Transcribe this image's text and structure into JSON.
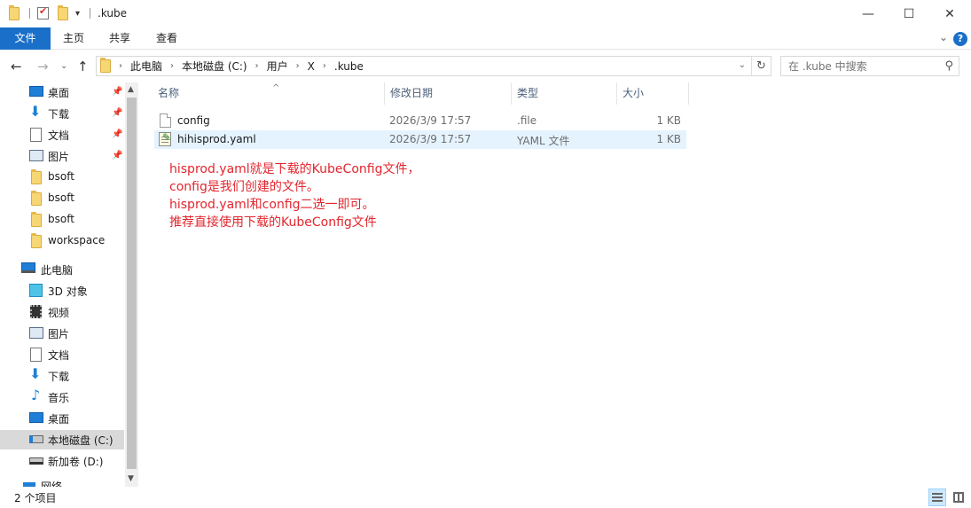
{
  "window": {
    "title": ".kube",
    "minimize_icon": "minimize-icon",
    "maximize_icon": "maximize-icon",
    "close_icon": "close-icon"
  },
  "ribbon": {
    "tabs": [
      "文件",
      "主页",
      "共享",
      "查看"
    ],
    "help_glyph": "?"
  },
  "address": {
    "crumbs": [
      "此电脑",
      "本地磁盘 (C:)",
      "用户",
      "X",
      ".kube"
    ],
    "search_placeholder": "在 .kube 中搜索"
  },
  "sidebar": {
    "quick_access": [
      {
        "label": "桌面",
        "icon": "desktop-icon",
        "pinned": true
      },
      {
        "label": "下载",
        "icon": "download-icon",
        "pinned": true
      },
      {
        "label": "文档",
        "icon": "documents-icon",
        "pinned": true
      },
      {
        "label": "图片",
        "icon": "pictures-icon",
        "pinned": true
      },
      {
        "label": "bsoft",
        "icon": "folder-icon",
        "pinned": false
      },
      {
        "label": "bsoft",
        "icon": "folder-icon",
        "pinned": false
      },
      {
        "label": "bsoft",
        "icon": "folder-icon",
        "pinned": false
      },
      {
        "label": "workspace",
        "icon": "folder-icon",
        "pinned": false
      }
    ],
    "this_pc": "此电脑",
    "pc_items": [
      {
        "label": "3D 对象",
        "icon": "3d-objects-icon"
      },
      {
        "label": "视频",
        "icon": "videos-icon"
      },
      {
        "label": "图片",
        "icon": "pictures-icon"
      },
      {
        "label": "文档",
        "icon": "documents-icon"
      },
      {
        "label": "下载",
        "icon": "download-icon"
      },
      {
        "label": "音乐",
        "icon": "music-icon"
      },
      {
        "label": "桌面",
        "icon": "desktop-icon"
      },
      {
        "label": "本地磁盘 (C:)",
        "icon": "drive-c-icon",
        "selected": true
      },
      {
        "label": "新加卷 (D:)",
        "icon": "drive-d-icon"
      }
    ],
    "partial_item": "网络"
  },
  "columns": {
    "name": "名称",
    "date": "修改日期",
    "type": "类型",
    "size": "大小"
  },
  "files": [
    {
      "name": "config",
      "date": "2026/3/9 17:57",
      "type": ".file",
      "size": "1 KB",
      "icon": "file-icon"
    },
    {
      "name": "hihisprod.yaml",
      "date": "2026/3/9 17:57",
      "type": "YAML 文件",
      "size": "1 KB",
      "icon": "yaml-file-icon"
    }
  ],
  "annotation": {
    "lines": [
      "hisprod.yaml就是下载的KubeConfig文件，",
      "config是我们创建的文件。",
      "hisprod.yaml和config二选一即可。",
      "推荐直接使用下载的KubeConfig文件"
    ],
    "color": "#e3262e"
  },
  "status": {
    "item_count": "2 个项目"
  },
  "colors": {
    "accent": "#1a6fc9",
    "selected_row": "#e5f3ff",
    "selected_nav": "#d9d9d9"
  }
}
